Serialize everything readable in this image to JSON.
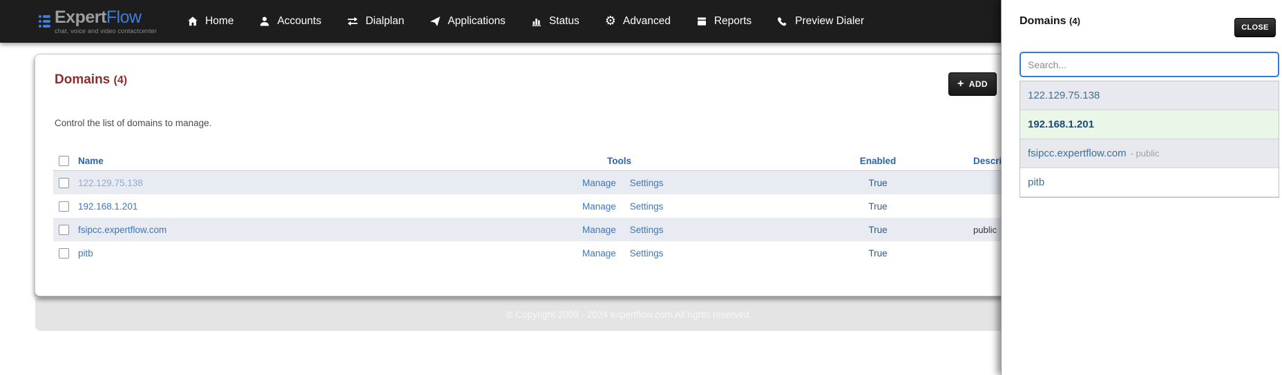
{
  "navbar": {
    "logo": {
      "expert": "Expert",
      "flow": "Flow",
      "tagline": "chat, voice and video contactcenter"
    },
    "items": [
      {
        "label": "Home"
      },
      {
        "label": "Accounts"
      },
      {
        "label": "Dialplan"
      },
      {
        "label": "Applications"
      },
      {
        "label": "Status"
      },
      {
        "label": "Advanced"
      },
      {
        "label": "Reports"
      },
      {
        "label": "Preview Dialer"
      }
    ]
  },
  "main": {
    "title": "Domains",
    "count": "(4)",
    "subtitle": "Control the list of domains to manage.",
    "add_button": "ADD",
    "add_plus": "+",
    "table": {
      "headers": [
        "Name",
        "Tools",
        "Enabled",
        "Description"
      ],
      "rows": [
        {
          "name": "122.129.75.138",
          "tools": [
            "Manage",
            "Settings"
          ],
          "enabled": "True",
          "description": ""
        },
        {
          "name": "192.168.1.201",
          "tools": [
            "Manage",
            "Settings"
          ],
          "enabled": "True",
          "description": ""
        },
        {
          "name": "fsipcc.expertflow.com",
          "tools": [
            "Manage",
            "Settings"
          ],
          "enabled": "True",
          "description": "public"
        },
        {
          "name": "pitb",
          "tools": [
            "Manage",
            "Settings"
          ],
          "enabled": "True",
          "description": ""
        }
      ]
    }
  },
  "footer": {
    "copyright": "© Copyright 2008 - 2024 expertflow.com All rights reserved."
  },
  "panel": {
    "title": "Domains",
    "count": "(4)",
    "close_button": "CLOSE",
    "search": {
      "value": "",
      "placeholder": "Search..."
    },
    "items": [
      {
        "label": "122.129.75.138",
        "suffix": ""
      },
      {
        "label": "192.168.1.201",
        "suffix": ""
      },
      {
        "label": "fsipcc.expertflow.com",
        "suffix": "- public"
      },
      {
        "label": "pitb",
        "suffix": ""
      }
    ]
  },
  "colors": {
    "navbar_bg": "#1d1d1d",
    "brand_blue": "#3e7fd9",
    "heading_maroon": "#8b2d2d",
    "link_blue": "#3a77bd",
    "table_header_blue": "#2a63ad",
    "row_stripe": "#e8ebf2",
    "active_domain_green": "#eaf6e8",
    "search_focus_blue": "#2f7bd9",
    "footer_band": "#e4e4e4"
  }
}
